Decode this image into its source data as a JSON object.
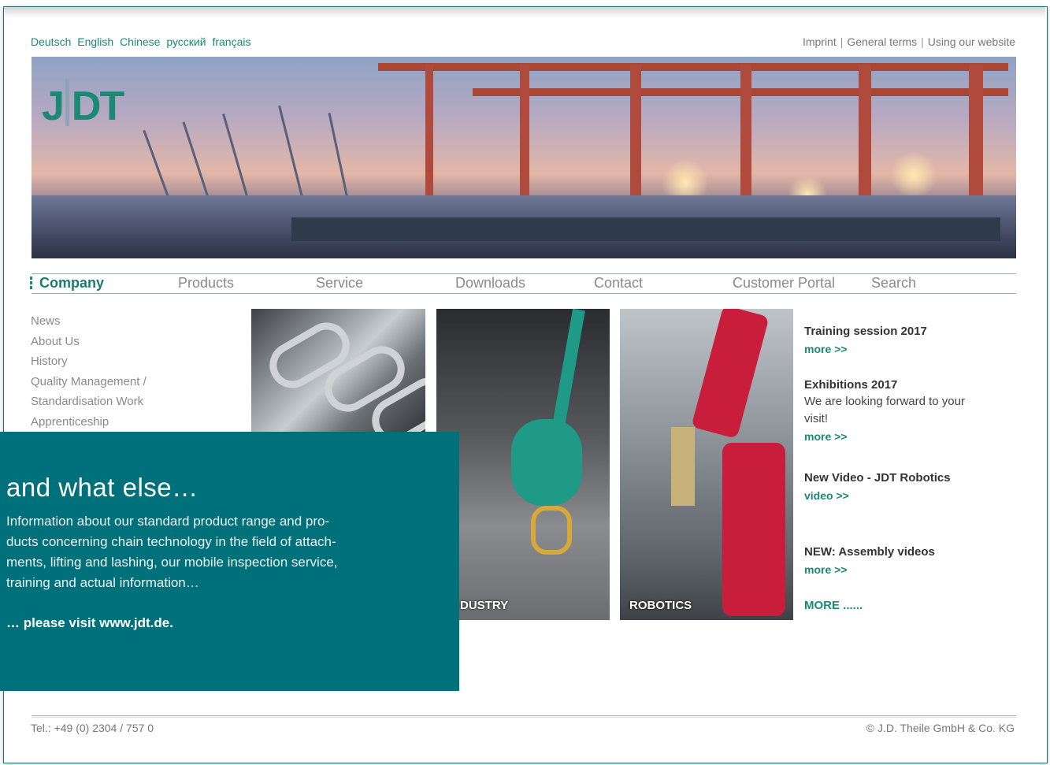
{
  "languages": [
    "Deutsch",
    "English",
    "Chinese",
    "русский",
    "français"
  ],
  "toplinks": {
    "imprint": "Imprint",
    "terms": "General terms",
    "using": "Using our website",
    "sep": "|"
  },
  "logo": {
    "text_left": "J",
    "text_right": "DT"
  },
  "nav": {
    "company": "Company",
    "products": "Products",
    "service": "Service",
    "downloads": "Downloads",
    "contact": "Contact",
    "portal": "Customer Portal",
    "search": "Search"
  },
  "sidemenu": {
    "news": "News",
    "about": "About Us",
    "history": "History",
    "quality1": "Quality Management /",
    "quality2": "Standardisation Work",
    "apprenticeship": "Apprenticeship"
  },
  "tiles": {
    "industry": "DUSTRY",
    "robotics": "ROBOTICS"
  },
  "news": {
    "n1_title": "Training session 2017",
    "n1_more": "more >>",
    "n2_title": "Exhibitions 2017",
    "n2_text1": "We are looking forward to your",
    "n2_text2": "visit!",
    "n2_more": "more >>",
    "n3_title": "New Video - JDT Robotics",
    "n3_more": "video >>",
    "n4_title": "NEW: Assembly videos",
    "n4_more": "more >>",
    "more_all": "MORE ......"
  },
  "overlay": {
    "heading": "and what else…",
    "line1": "Information about our standard product range and pro-",
    "line2": "ducts concerning chain technology in the field of attach-",
    "line3": "ments, lifting and lashing, our mobile inspection service,",
    "line4": "training and actual information…",
    "visit": "… please visit www.jdt.de."
  },
  "footer": {
    "tel": "Tel.: +49 (0) 2304 / 757 0",
    "copyright": "© J.D. Theile GmbH & Co. KG"
  },
  "colors": {
    "brand_green": "#1a8a74",
    "overlay_teal": "#00707a",
    "robot_red": "#c81e3c"
  }
}
